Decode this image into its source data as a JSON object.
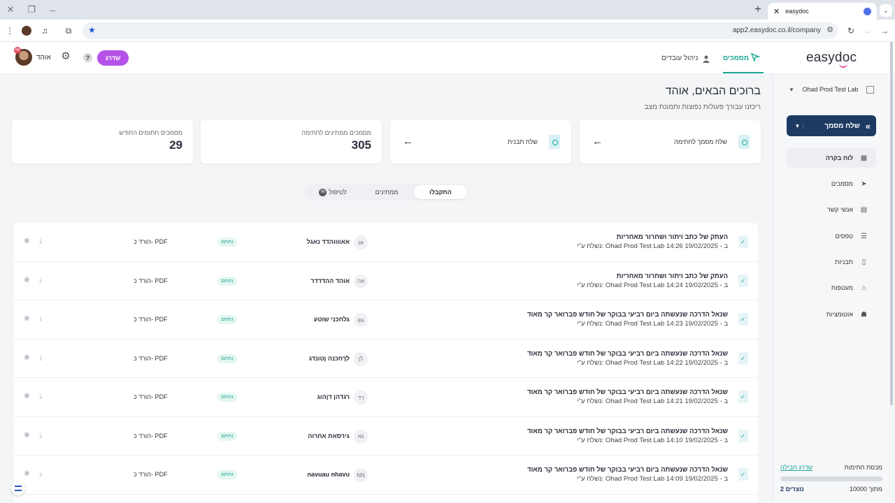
{
  "browser": {
    "tab_title": "easydoc",
    "url": "app2.easydoc.co.il/company"
  },
  "header": {
    "username": "אוהד",
    "notification_count": "99",
    "upgrade_label": "שדרג",
    "help_label": "?",
    "nav": {
      "employees": "ניהול עובדים",
      "documents": "מסמכים"
    },
    "logo": "easydoc"
  },
  "sidebar": {
    "org_name": "Ohad Prod Test Lab",
    "send_button": "שלח מסמך",
    "items": [
      {
        "label": "לוח בקרה",
        "icon": "dashboard-icon",
        "active": true
      },
      {
        "label": "מסמכים",
        "icon": "cursor-icon",
        "active": false
      },
      {
        "label": "אנשי קשר",
        "icon": "contacts-icon",
        "active": false
      },
      {
        "label": "טפסים",
        "icon": "forms-icon",
        "active": false
      },
      {
        "label": "תבניות",
        "icon": "template-icon",
        "active": false
      },
      {
        "label": "מעטפות",
        "icon": "envelope-icon",
        "active": false
      },
      {
        "label": "אוטומציות",
        "icon": "robot-icon",
        "active": false
      }
    ],
    "plan": {
      "title": "מכסת חתימות",
      "upgrade_link": "שדרג חבילה",
      "used": "2 נוצרים",
      "total": "מתוך 10000"
    }
  },
  "main": {
    "welcome": "ברוכים הבאים, אוהד",
    "subtitle": "ריכזנו עבורך פעולות נפוצות ותמונת מצב",
    "cards": {
      "send_doc": "שלח מסמך לחתימה",
      "send_template": "שלח תבנית",
      "pending_label": "מסמכים ממתינים לחתימה",
      "pending_value": "305",
      "signed_label": "מסמכים חתומים החודש",
      "signed_value": "29"
    },
    "tabs": {
      "received": "התקבלו",
      "pending": "ממתינים",
      "todo": "לטיפול",
      "todo_count": "99"
    },
    "rows": [
      {
        "title": "העתק של כתב ויתור ושחרור מאחריות",
        "meta": "נשלח ע\"י: Ohad Prod Test Lab ב - 19/02/2025 14:26",
        "initials": "אנ",
        "signer": "אאווווהדד נאגל",
        "status": "נחתם",
        "download": "הורד כ- PDF"
      },
      {
        "title": "העתק של כתב ויתור ושחרור מאחריות",
        "meta": "נשלח ע\"י: Ohad Prod Test Lab ב - 19/02/2025 14:24",
        "initials": "אה",
        "signer": "אוהד ההדדדר",
        "status": "נחתם",
        "download": "הורד כ- PDF"
      },
      {
        "title": "שנאל הדרכה שנעשתה ביום רביעי בבוקר של חודש פברואר קר מאוד",
        "meta": "נשלח ע\"י: Ohad Prod Test Lab ב - 19/02/2025 14:23",
        "initials": "גש",
        "signer": "גלחכני שוטע",
        "status": "נחתם",
        "download": "הורד כ- PDF"
      },
      {
        "title": "שנאל הדרכה שנעשתה ביום רביעי בבוקר של חודש פברואר קר מאוד",
        "meta": "נשלח ע\"י: Ohad Prod Test Lab ב - 19/02/2025 14:22",
        "initials": "לן",
        "signer": "לךחכנה ןטונדג",
        "status": "נחתם",
        "download": "הורד כ- PDF"
      },
      {
        "title": "שנאל הדרכה שנעשתה ביום רביעי בבוקר של חודש פברואר קר מאוד",
        "meta": "נשלח ע\"י: Ohad Prod Test Lab ב - 19/02/2025 14:21",
        "initials": "רד",
        "signer": "רגדהן דןהוג",
        "status": "נחתם",
        "download": "הורד כ- PDF"
      },
      {
        "title": "שנאל הדרכה שנעשתה ביום רביעי בבוקר של חודש פברואר קר מאוד",
        "meta": "נשלח ע\"י: Ohad Prod Test Lab ב - 19/02/2025 14:10",
        "initials": "גא",
        "signer": "גירסאת אחרוה",
        "status": "נחתם",
        "download": "הורד כ- PDF"
      },
      {
        "title": "שנאל הדרכה שנעשתה ביום רביעי בבוקר של חודש פברואר קר מאוד",
        "meta": "נשלח ע\"י: Ohad Prod Test Lab ב - 19/02/2025 14:09",
        "initials": "NN",
        "signer": "navuau nhavu",
        "status": "נחתם",
        "download": "הורד כ- PDF"
      }
    ]
  },
  "colors": {
    "accent": "#1aa894",
    "primary": "#1d3a63",
    "upgrade": "#b553e8"
  }
}
